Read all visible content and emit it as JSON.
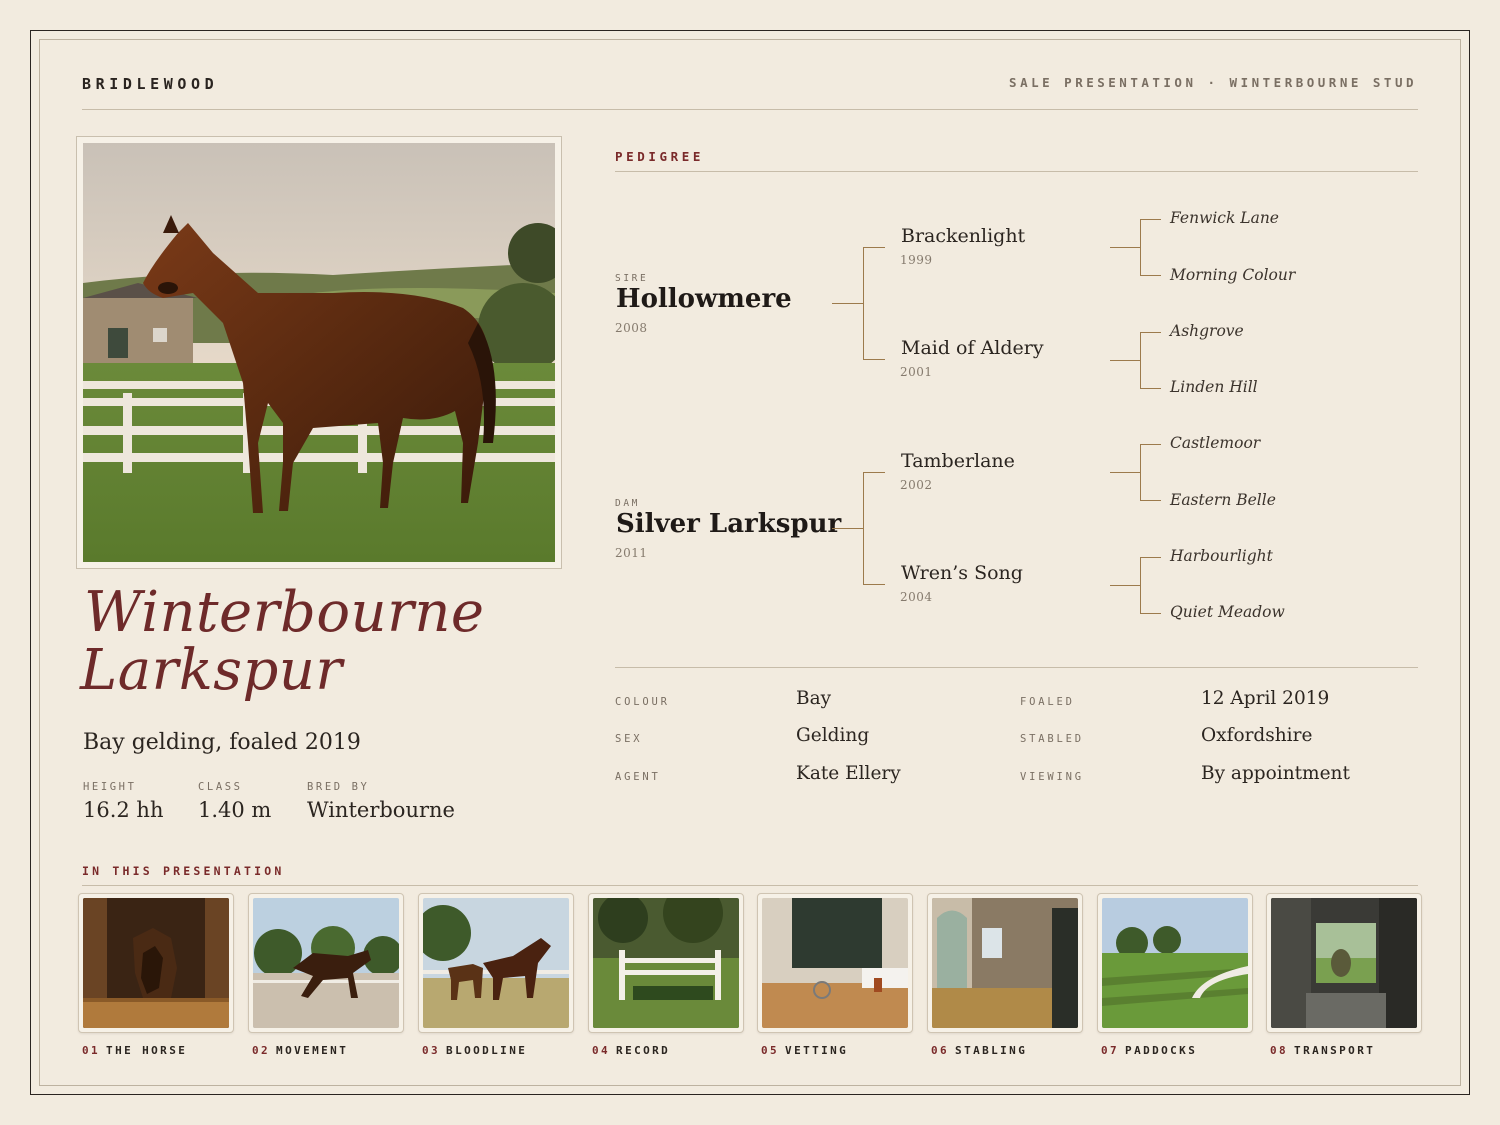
{
  "header": {
    "brand": "BRIDLEWOOD",
    "context": "SALE PRESENTATION · WINTERBOURNE STUD"
  },
  "horse": {
    "name_line1": "Winterbourne",
    "name_line2": "Larkspur",
    "subtitle": "Bay gelding, foaled 2019",
    "stats": [
      {
        "label": "HEIGHT",
        "value": "16.2 hh"
      },
      {
        "label": "CLASS",
        "value": "1.40 m"
      },
      {
        "label": "BRED BY",
        "value": "Winterbourne"
      }
    ]
  },
  "pedigree": {
    "title": "PEDIGREE",
    "sire": {
      "role": "SIRE",
      "name": "Hollowmere",
      "year": "2008",
      "sire": {
        "name": "Brackenlight",
        "year": "1999",
        "parents": [
          "Fenwick Lane",
          "Morning Colour"
        ]
      },
      "dam": {
        "name": "Maid of Aldery",
        "year": "2001",
        "parents": [
          "Ashgrove",
          "Linden Hill"
        ]
      }
    },
    "dam": {
      "role": "DAM",
      "name": "Silver Larkspur",
      "year": "2011",
      "sire": {
        "name": "Tamberlane",
        "year": "2002",
        "parents": [
          "Castlemoor",
          "Eastern Belle"
        ]
      },
      "dam": {
        "name": "Wren’s Song",
        "year": "2004",
        "parents": [
          "Harbourlight",
          "Quiet Meadow"
        ]
      }
    }
  },
  "details": [
    {
      "label": "COLOUR",
      "value": "Bay"
    },
    {
      "label": "FOALED",
      "value": "12 April 2019"
    },
    {
      "label": "SEX",
      "value": "Gelding"
    },
    {
      "label": "STABLED",
      "value": "Oxfordshire"
    },
    {
      "label": "AGENT",
      "value": "Kate Ellery"
    },
    {
      "label": "VIEWING",
      "value": "By appointment"
    }
  ],
  "gallery": {
    "title": "IN THIS PRESENTATION",
    "items": [
      {
        "num": "01",
        "label": "THE HORSE"
      },
      {
        "num": "02",
        "label": "MOVEMENT"
      },
      {
        "num": "03",
        "label": "BLOODLINE"
      },
      {
        "num": "04",
        "label": "RECORD"
      },
      {
        "num": "05",
        "label": "VETTING"
      },
      {
        "num": "06",
        "label": "STABLING"
      },
      {
        "num": "07",
        "label": "PADDOCKS"
      },
      {
        "num": "08",
        "label": "TRANSPORT"
      }
    ]
  },
  "colors": {
    "accent": "#6e2a2a",
    "background": "#f2ebdf",
    "pedigree_line": "#9c7a4c"
  }
}
